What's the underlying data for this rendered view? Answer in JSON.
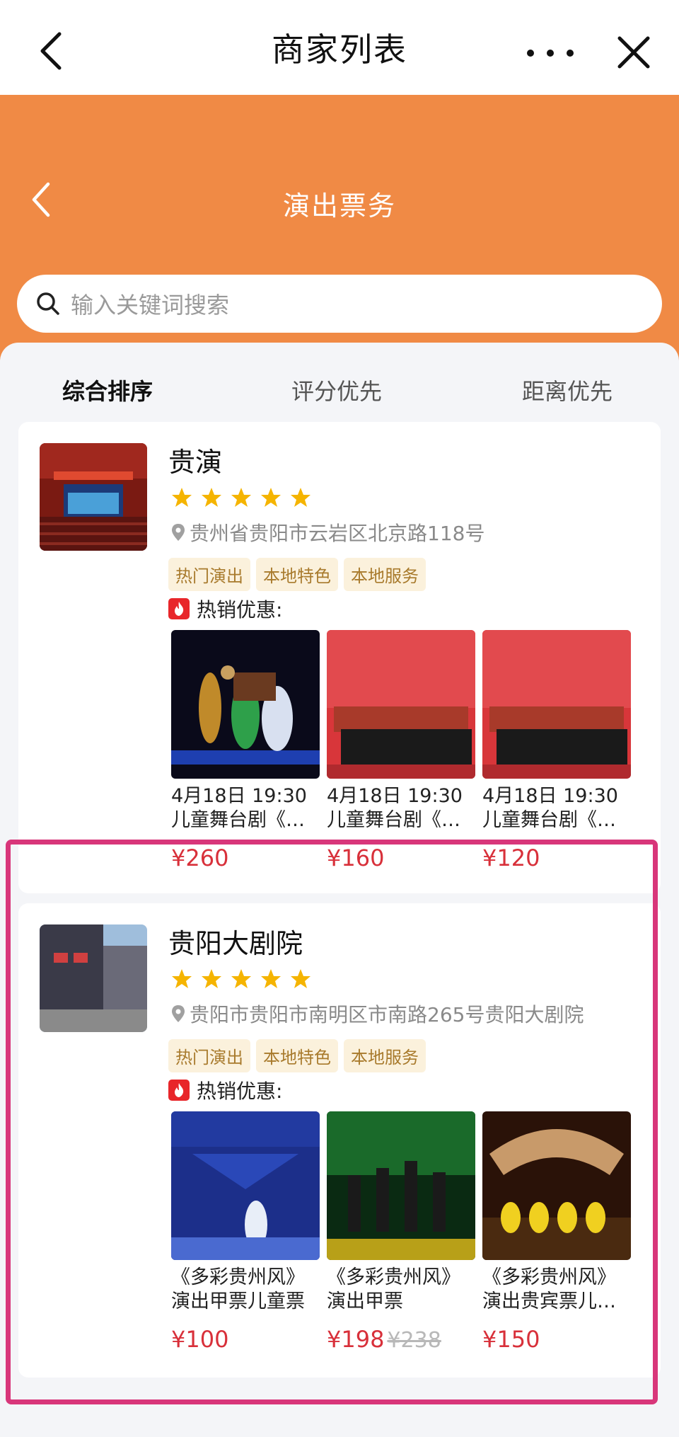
{
  "topbar": {
    "title": "商家列表"
  },
  "header": {
    "title": "演出票务"
  },
  "search": {
    "placeholder": "输入关键词搜索"
  },
  "sort_tabs": [
    "综合排序",
    "评分优先",
    "距离优先"
  ],
  "colors": {
    "accent": "#f08a45",
    "price": "#d8303a",
    "star": "#f5b400",
    "highlight": "#d8367a"
  },
  "merchants": [
    {
      "name": "贵演",
      "rating": 5,
      "address": "贵州省贵阳市云岩区北京路118号",
      "tags": [
        "热门演出",
        "本地特色",
        "本地服务"
      ],
      "hot_label": "热销优惠:",
      "items": [
        {
          "line1": "4月18日 19:30",
          "line2": "儿童舞台剧《…",
          "price": "¥260"
        },
        {
          "line1": "4月18日 19:30",
          "line2": "儿童舞台剧《…",
          "price": "¥160"
        },
        {
          "line1": "4月18日 19:30",
          "line2": "儿童舞台剧《…",
          "price": "¥120"
        }
      ]
    },
    {
      "name": "贵阳大剧院",
      "rating": 5,
      "address": "贵阳市贵阳市南明区市南路265号贵阳大剧院",
      "tags": [
        "热门演出",
        "本地特色",
        "本地服务"
      ],
      "hot_label": "热销优惠:",
      "items": [
        {
          "line1": "《多彩贵州风》",
          "line2": "演出甲票儿童票",
          "price": "¥100"
        },
        {
          "line1": "《多彩贵州风》",
          "line2": "演出甲票",
          "price": "¥198",
          "orig_price": "¥238"
        },
        {
          "line1": "《多彩贵州风》",
          "line2": "演出贵宾票儿…",
          "price": "¥150"
        }
      ]
    }
  ]
}
